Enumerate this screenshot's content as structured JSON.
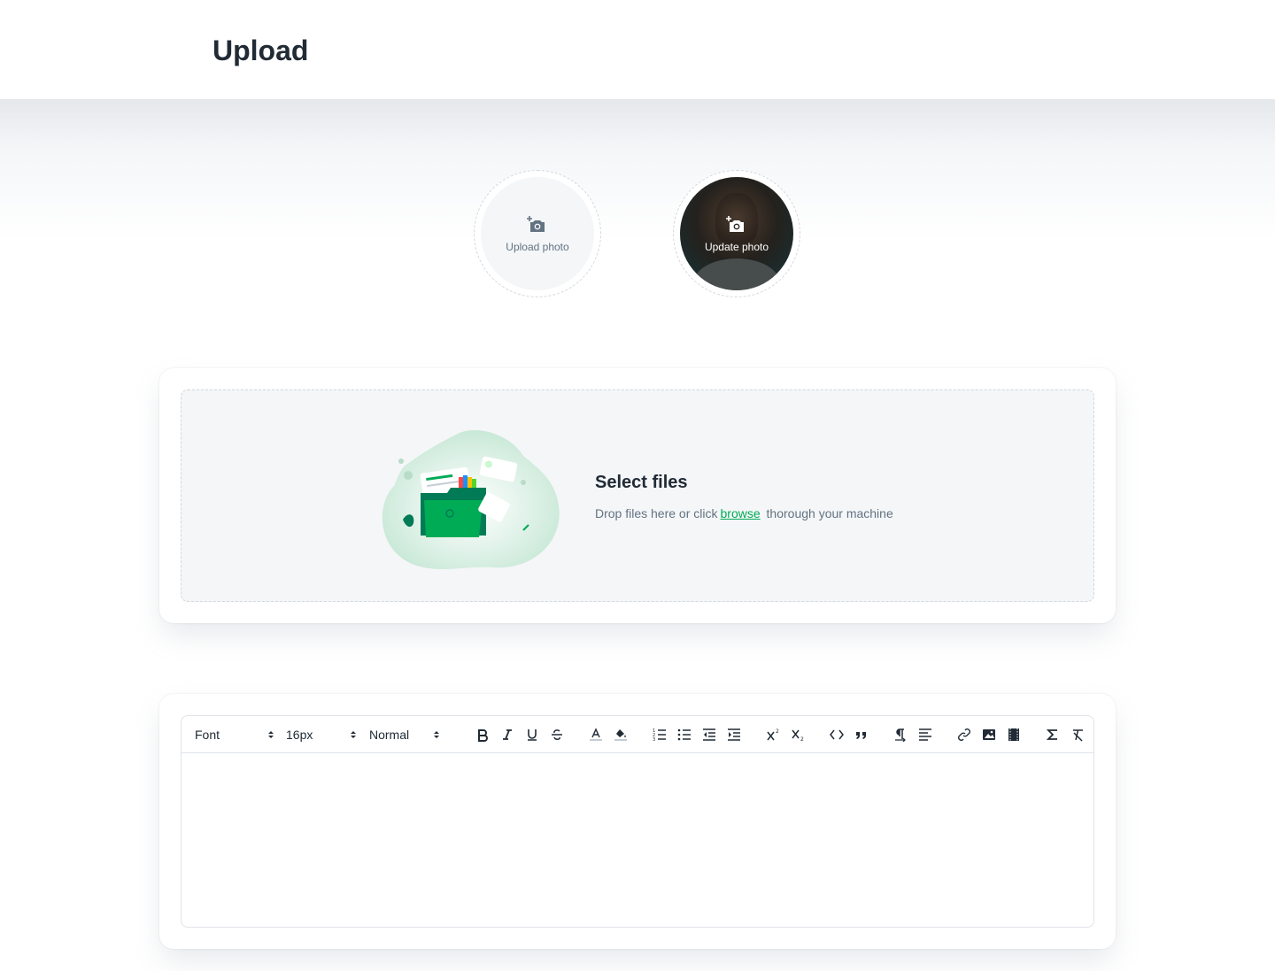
{
  "page": {
    "title": "Upload"
  },
  "avatars": [
    {
      "label": "Upload photo",
      "has_photo": false
    },
    {
      "label": "Update photo",
      "has_photo": true
    }
  ],
  "dropzone": {
    "title": "Select files",
    "desc_before": "Drop files here or click",
    "link": "browse",
    "desc_after": "thorough your machine"
  },
  "editor": {
    "font_select": "Font",
    "size_select": "16px",
    "heading_select": "Normal",
    "buttons": [
      "bold",
      "italic",
      "underline",
      "strike",
      "color",
      "background",
      "ordered-list",
      "bullet-list",
      "indent-decrease",
      "indent-increase",
      "superscript",
      "subscript",
      "code-block",
      "blockquote",
      "text-direction",
      "align",
      "link",
      "image",
      "video",
      "formula",
      "clean"
    ]
  },
  "colors": {
    "primary": "#00ab55",
    "text": "#212b36",
    "muted": "#637381",
    "neutral_bg": "#f4f6f8"
  }
}
